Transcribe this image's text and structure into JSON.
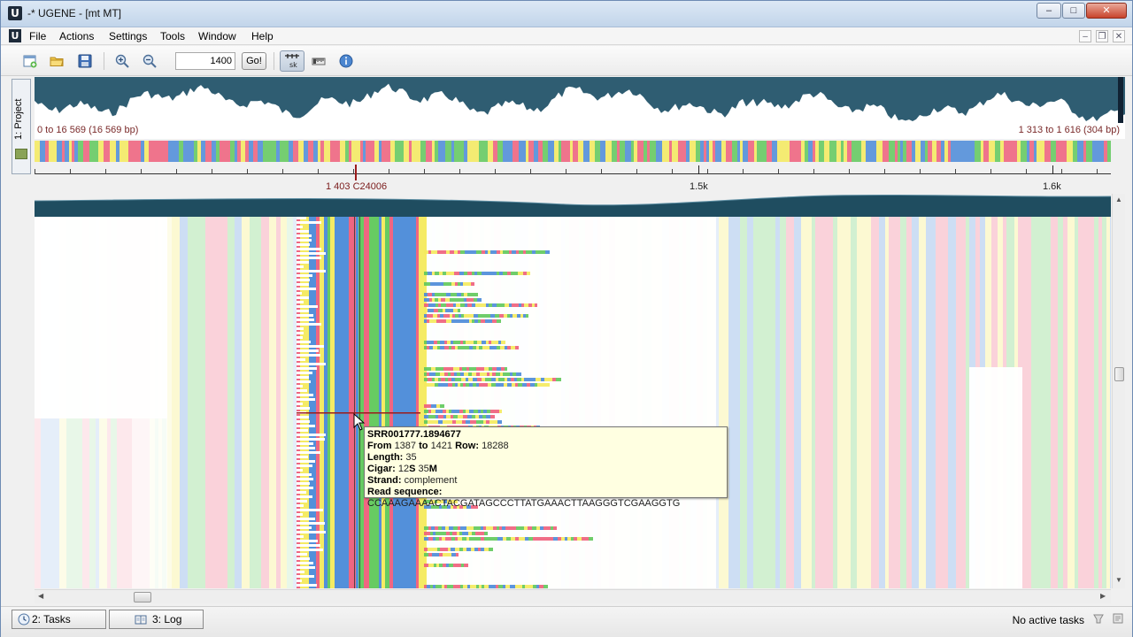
{
  "window": {
    "title": "-* UGENE - [mt MT]",
    "controls": {
      "minimize": "–",
      "maximize": "□",
      "close": "✕"
    }
  },
  "menubar": {
    "items": [
      "File",
      "Actions",
      "Settings",
      "Tools",
      "Window",
      "Help"
    ],
    "mdi_controls": {
      "minimize": "–",
      "restore": "❐",
      "close": "✕"
    }
  },
  "toolbar": {
    "position_value": "1400",
    "go_label": "Go!",
    "toggle_label": "sk",
    "icons": [
      "new-document-icon",
      "open-folder-icon",
      "save-icon",
      "zoom-in-icon",
      "zoom-out-icon",
      "show-reads-toggle-icon",
      "ruler-icon",
      "info-icon"
    ]
  },
  "side_panel": {
    "project_label": "1: Project"
  },
  "overview": {
    "left_range": "0 to 16 569 (16 569 bp)",
    "right_range": "1 313 to 1 616 (304 bp)"
  },
  "ruler": {
    "cursor_label": "1 403 C24006",
    "tick_labels": [
      "1.5k",
      "1.6k"
    ]
  },
  "tooltip": {
    "read_name": "SRR001777.1894677",
    "from_label": "From",
    "from": "1387",
    "to_label": "to",
    "to": "1421",
    "row_label": "Row:",
    "row": "18288",
    "length_label": "Length:",
    "length": "35",
    "cigar_label": "Cigar:",
    "cigar_pre": "12",
    "cigar_s": "S",
    "cigar_mid": " 35",
    "cigar_m": "M",
    "strand_label": "Strand:",
    "strand": "complement",
    "readseq_label": "Read sequence:",
    "readseq": "CCAAAGAAAACTACGATAGCCCTTATGAAACTTAAGGGTCGAAGGTG"
  },
  "statusbar": {
    "tasks_label": "2: Tasks",
    "log_label": "3: Log",
    "status_text": "No active tasks"
  },
  "colors": {
    "A": "#ee5e7a",
    "C": "#4a8ad8",
    "G": "#f4ea5c",
    "T": "#5fc85a",
    "overview_fill": "#2f5d72",
    "cursor": "#9b1c1c"
  }
}
